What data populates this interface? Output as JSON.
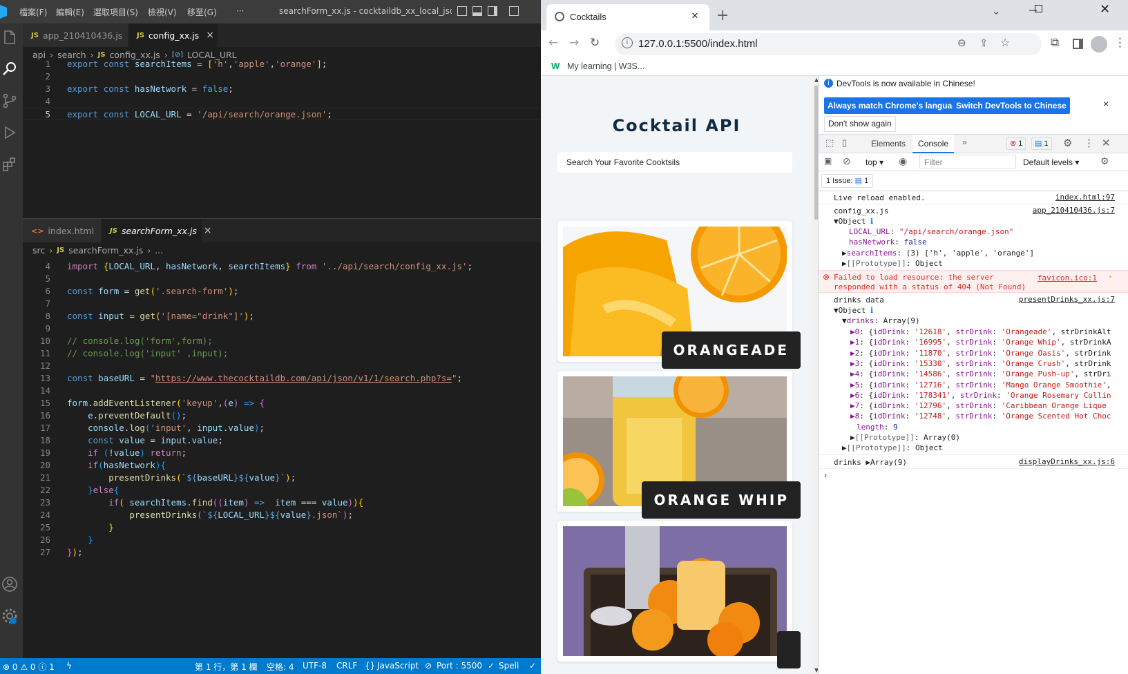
{
  "vscode": {
    "menu": [
      "檔案(F)",
      "編輯(E)",
      "選取項目(S)",
      "檢視(V)",
      "移至(G)",
      "···"
    ],
    "window_title": "searchForm_xx.js - cocktaildb_xx_local_json_xx...",
    "top_group": {
      "tabs": [
        {
          "label": "app_210410436.js",
          "active": false
        },
        {
          "label": "config_xx.js",
          "active": true
        }
      ],
      "breadcrumb": [
        "api",
        "search",
        "config_xx.js",
        "LOCAL_URL"
      ],
      "lines": [
        "1",
        "2",
        "3",
        "4",
        "5"
      ]
    },
    "bottom_group": {
      "tabs": [
        {
          "label": "index.html",
          "active": false
        },
        {
          "label": "searchForm_xx.js",
          "active": true
        }
      ],
      "breadcrumb": [
        "src",
        "searchForm_xx.js",
        "..."
      ],
      "lines": [
        "4",
        "5",
        "6",
        "7",
        "8",
        "9",
        "10",
        "11",
        "12",
        "13",
        "14",
        "15",
        "16",
        "17",
        "18",
        "19",
        "20",
        "21",
        "22",
        "23",
        "24",
        "25",
        "26",
        "27"
      ]
    },
    "statusbar": {
      "problems": "⊗ 0 ⚠ 0 ⓘ 1",
      "position": "第 1 行，第 1 欄",
      "spaces": "空格: 4",
      "encoding": "UTF-8",
      "eol": "CRLF",
      "language": "JavaScript",
      "port": "Port : 5500",
      "spell": "Spell"
    },
    "colors": {
      "statusbar": "#007acc",
      "activitybar": "#333333",
      "editor": "#1e1e1e"
    }
  },
  "chrome": {
    "tab_title": "Cocktails",
    "url": "127.0.0.1:5500/index.html",
    "bookmark": "My learning | W3S...",
    "page": {
      "title": "Cocktail API",
      "search_placeholder": "Search Your Favorite Cooktsils",
      "cards": [
        {
          "name": "ORANGEADE"
        },
        {
          "name": "ORANGE WHIP"
        },
        {
          "name": ""
        }
      ]
    },
    "devtools": {
      "banner": "DevTools is now available in Chinese!",
      "btn_match": "Always match Chrome's language",
      "btn_switch": "Switch DevTools to Chinese",
      "btn_dont": "Don't show again",
      "tabs": [
        "Elements",
        "Console"
      ],
      "errors_count": "1",
      "messages_count": "1",
      "context": "top",
      "filter_placeholder": "Filter",
      "levels": "Default levels",
      "issues": "1 Issue:",
      "issues_count": "1",
      "console": {
        "live_reload": "Live reload enabled.",
        "live_reload_src": "index.html:97",
        "config_label": "config_xx.js",
        "config_src": "app_210410436.js:7",
        "error_text_1": "Failed to load resource: the server",
        "error_text_2": "responded with a status of 404 (Not Found)",
        "error_src": "favicon.ico:1",
        "drinks_data_label": "drinks data",
        "drinks_data_src": "presentDrinks_xx.js:7",
        "drinks_label": "drinks",
        "drinks_value": "Array(9)",
        "drinks_src": "displayDrinks_xx.js:6",
        "drink_rows": [
          {
            "i": "0",
            "id": "'12618'",
            "name": "'Orangeade'",
            "tail": ", strDrinkAlt"
          },
          {
            "i": "1",
            "id": "'16995'",
            "name": "'Orange Whip'",
            "tail": ", strDrinkA"
          },
          {
            "i": "2",
            "id": "'11870'",
            "name": "'Orange Oasis'",
            "tail": ", strDrink"
          },
          {
            "i": "3",
            "id": "'15330'",
            "name": "'Orange Crush'",
            "tail": ", strDrink"
          },
          {
            "i": "4",
            "id": "'14586'",
            "name": "'Orange Push-up'",
            "tail": ", strDri"
          },
          {
            "i": "5",
            "id": "'12716'",
            "name": "'Mango Orange Smoothie'",
            "tail": ","
          },
          {
            "i": "6",
            "id": "'178341'",
            "name": "'Orange Rosemary Collin",
            "tail": ""
          },
          {
            "i": "7",
            "id": "'12796'",
            "name": "'Caribbean Orange Lique",
            "tail": ""
          },
          {
            "i": "8",
            "id": "'12748'",
            "name": "'Orange Scented Hot Choc",
            "tail": ""
          }
        ]
      }
    }
  }
}
